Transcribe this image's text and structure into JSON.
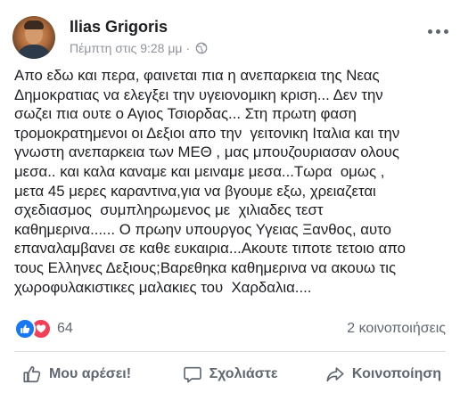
{
  "post": {
    "author": "Ilias Grigoris",
    "timestamp": "Πέμπτη στις 9:28 μμ",
    "separator": "·",
    "privacy_icon": "globe-icon",
    "text_lines": [
      "Απο εδω και περα, φαινεται πια η ανεπαρκεια της Νεας",
      "Δημοκρατιας να ελεγξει την υγειονομικη κριση... Δεν την",
      "σωζει πια ουτε ο Αγιος Τσιορδας... Στη πρωτη φαση",
      "τρομοκρατημενοι οι Δεξιοι απο την  γειτονικη Ιταλια και την",
      "γνωστη ανεπαρκεια των ΜΕΘ , μας μπουζουριασαν ολους",
      "μεσα.. και καλα καναμε και μειναμε μεσα...Τωρα  ομως ,",
      "μετα 45 μερες καραντινα,για να βγουμε εξω, χρειαζεται",
      "σχεδιασμος  συμπληρωμενος με  χιλιαδες τεστ",
      "καθημερινα...... Ο πρωην υπουργος Υγειας Ξανθος, αυτο",
      "επαναλαμβανει σε καθε ευκαιρια...Ακουτε τιποτε τετοιο απο",
      "τους Ελληνες Δεξιους;Βαρεθηκα καθημερινα να ακουω τις",
      "χωροφυλακιστικες μαλακιες του  Χαρδαλια...."
    ]
  },
  "stats": {
    "reaction_count": "64",
    "reaction_icons": [
      "like-icon",
      "love-icon"
    ],
    "shares": "2 κοινοποιήσεις"
  },
  "actions": {
    "like": "Μου αρέσει!",
    "comment": "Σχολιάστε",
    "share": "Κοινοποίηση"
  },
  "colors": {
    "like_blue": "#1877f2",
    "love_red": "#f33e58",
    "secondary_text": "#606770"
  }
}
